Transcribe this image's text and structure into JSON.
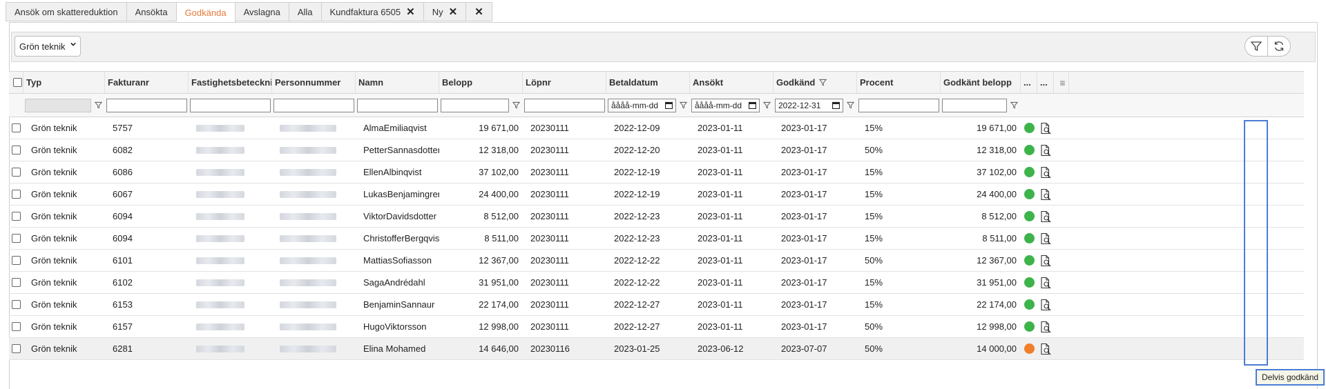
{
  "tabs": [
    {
      "label": "Ansök om skattereduktion",
      "active": false,
      "closable": false
    },
    {
      "label": "Ansökta",
      "active": false,
      "closable": false
    },
    {
      "label": "Godkända",
      "active": true,
      "closable": false
    },
    {
      "label": "Avslagna",
      "active": false,
      "closable": false
    },
    {
      "label": "Alla",
      "active": false,
      "closable": false
    },
    {
      "label": "Kundfaktura 6505",
      "active": false,
      "closable": true
    },
    {
      "label": "Ny",
      "active": false,
      "closable": true
    },
    {
      "label": "",
      "active": false,
      "closable": true
    }
  ],
  "toolbar": {
    "filter_select": "Grön teknik",
    "filter_icon": "funnel-icon",
    "refresh_icon": "refresh-icon"
  },
  "columns": {
    "typ": "Typ",
    "fakturanr": "Fakturanr",
    "fastighet": "Fastighetsbeteckning",
    "personnummer": "Personnummer",
    "namn": "Namn",
    "belopp": "Belopp",
    "lopnr": "Löpnr",
    "betaldatum": "Betaldatum",
    "ansokt": "Ansökt",
    "godkand": "Godkänd",
    "procent": "Procent",
    "godkant_belopp": "Godkänt belopp",
    "extra1": "...",
    "extra2": "..."
  },
  "filters": {
    "betaldatum": "åååå-mm-dd",
    "ansokt": "åååå-mm-dd",
    "godkand": "2022-12-31"
  },
  "colors": {
    "approved": "#3db34a",
    "partial": "#f07f2b",
    "accent": "#e8793a",
    "highlight": "#4a7cd6"
  },
  "rows": [
    {
      "typ": "Grön teknik",
      "fakturanr": "5757",
      "namn": "AlmaEmiliaqvist",
      "belopp": "19 671,00",
      "lopnr": "20230111",
      "betaldatum": "2022-12-09",
      "ansokt": "2023-01-11",
      "godkand": "2023-01-17",
      "procent": "15%",
      "godkant_belopp": "19 671,00",
      "status": "approved"
    },
    {
      "typ": "Grön teknik",
      "fakturanr": "6082",
      "namn": "PetterSannasdotter",
      "belopp": "12 318,00",
      "lopnr": "20230111",
      "betaldatum": "2022-12-20",
      "ansokt": "2023-01-11",
      "godkand": "2023-01-17",
      "procent": "50%",
      "godkant_belopp": "12 318,00",
      "status": "approved"
    },
    {
      "typ": "Grön teknik",
      "fakturanr": "6086",
      "namn": "EllenAlbinqvist",
      "belopp": "37 102,00",
      "lopnr": "20230111",
      "betaldatum": "2022-12-19",
      "ansokt": "2023-01-11",
      "godkand": "2023-01-17",
      "procent": "15%",
      "godkant_belopp": "37 102,00",
      "status": "approved"
    },
    {
      "typ": "Grön teknik",
      "fakturanr": "6067",
      "namn": "LukasBenjamingren",
      "belopp": "24 400,00",
      "lopnr": "20230111",
      "betaldatum": "2022-12-19",
      "ansokt": "2023-01-11",
      "godkand": "2023-01-17",
      "procent": "15%",
      "godkant_belopp": "24 400,00",
      "status": "approved"
    },
    {
      "typ": "Grön teknik",
      "fakturanr": "6094",
      "namn": "ViktorDavidsdotter",
      "belopp": "8 512,00",
      "lopnr": "20230111",
      "betaldatum": "2022-12-23",
      "ansokt": "2023-01-11",
      "godkand": "2023-01-17",
      "procent": "15%",
      "godkant_belopp": "8 512,00",
      "status": "approved"
    },
    {
      "typ": "Grön teknik",
      "fakturanr": "6094",
      "namn": "ChristofferBergqvist",
      "belopp": "8 511,00",
      "lopnr": "20230111",
      "betaldatum": "2022-12-23",
      "ansokt": "2023-01-11",
      "godkand": "2023-01-17",
      "procent": "15%",
      "godkant_belopp": "8 511,00",
      "status": "approved"
    },
    {
      "typ": "Grön teknik",
      "fakturanr": "6101",
      "namn": "MattiasSofiasson",
      "belopp": "12 367,00",
      "lopnr": "20230111",
      "betaldatum": "2022-12-22",
      "ansokt": "2023-01-11",
      "godkand": "2023-01-17",
      "procent": "50%",
      "godkant_belopp": "12 367,00",
      "status": "approved"
    },
    {
      "typ": "Grön teknik",
      "fakturanr": "6102",
      "namn": "SagaAndrédahl",
      "belopp": "31 951,00",
      "lopnr": "20230111",
      "betaldatum": "2022-12-22",
      "ansokt": "2023-01-11",
      "godkand": "2023-01-17",
      "procent": "15%",
      "godkant_belopp": "31 951,00",
      "status": "approved"
    },
    {
      "typ": "Grön teknik",
      "fakturanr": "6153",
      "namn": "BenjaminSannaur",
      "belopp": "22 174,00",
      "lopnr": "20230111",
      "betaldatum": "2022-12-27",
      "ansokt": "2023-01-11",
      "godkand": "2023-01-17",
      "procent": "15%",
      "godkant_belopp": "22 174,00",
      "status": "approved"
    },
    {
      "typ": "Grön teknik",
      "fakturanr": "6157",
      "namn": "HugoViktorsson",
      "belopp": "12 998,00",
      "lopnr": "20230111",
      "betaldatum": "2022-12-27",
      "ansokt": "2023-01-11",
      "godkand": "2023-01-17",
      "procent": "50%",
      "godkant_belopp": "12 998,00",
      "status": "approved"
    },
    {
      "typ": "Grön teknik",
      "fakturanr": "6281",
      "namn": "Elina Mohamed",
      "belopp": "14 646,00",
      "lopnr": "20230116",
      "betaldatum": "2023-01-25",
      "ansokt": "2023-06-12",
      "godkand": "2023-07-07",
      "procent": "50%",
      "godkant_belopp": "14 000,00",
      "status": "partial"
    }
  ],
  "tooltip": "Delvis godkänd"
}
